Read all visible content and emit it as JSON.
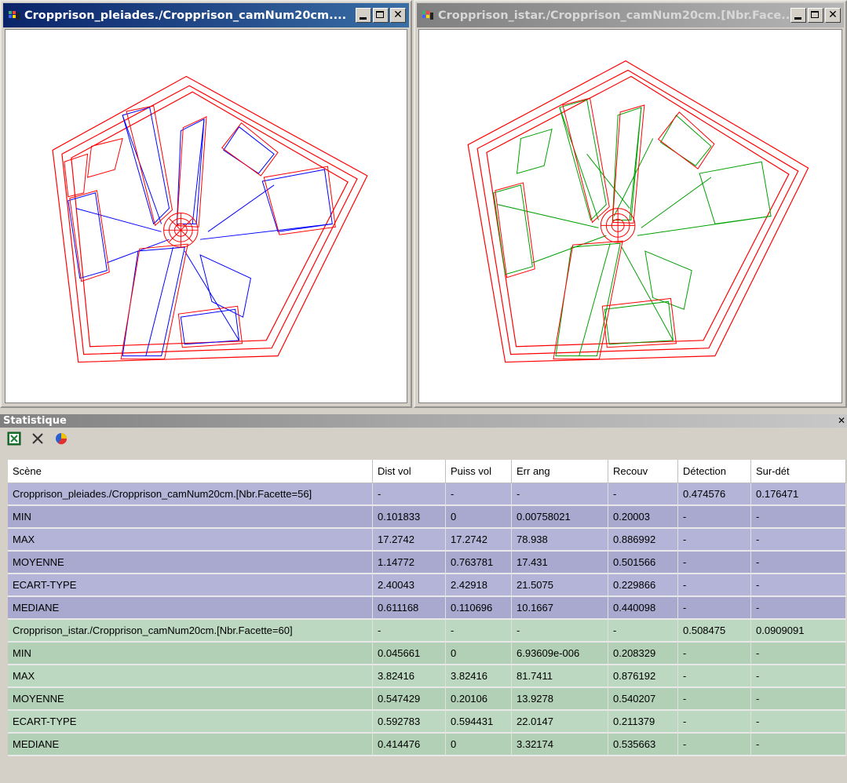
{
  "windows": {
    "left": {
      "title": "Cropprison_pleiades./Cropprison_camNum20cm...."
    },
    "right": {
      "title": "Cropprison_istar./Cropprison_camNum20cm.[Nbr.Face..."
    }
  },
  "colors": {
    "footprint": "#ff0000",
    "left_model": "#0000ff",
    "right_model": "#00a000",
    "group1_row": "#b4b4d8",
    "group2_row": "#bcd8c0"
  },
  "stats": {
    "title": "Statistique",
    "toolbar": [
      "excel-icon",
      "delete-icon",
      "chart-icon"
    ],
    "columns": [
      "Scène",
      "Dist vol",
      "Puiss vol",
      "Err ang",
      "Recouv",
      "Détection",
      "Sur-dét"
    ],
    "groups": [
      {
        "name": "Cropprison_pleiades./Cropprison_camNum20cm.[Nbr.Facette=56]",
        "header": [
          "-",
          "-",
          "-",
          "-",
          "0.474576",
          "0.176471"
        ],
        "rows": [
          [
            "MIN",
            "0.101833",
            "0",
            "0.00758021",
            "0.20003",
            "-",
            "-"
          ],
          [
            "MAX",
            "17.2742",
            "17.2742",
            "78.938",
            "0.886992",
            "-",
            "-"
          ],
          [
            "MOYENNE",
            "1.14772",
            "0.763781",
            "17.431",
            "0.501566",
            "-",
            "-"
          ],
          [
            "ECART-TYPE",
            "2.40043",
            "2.42918",
            "21.5075",
            "0.229866",
            "-",
            "-"
          ],
          [
            "MEDIANE",
            "0.611168",
            "0.110696",
            "10.1667",
            "0.440098",
            "-",
            "-"
          ]
        ]
      },
      {
        "name": "Cropprison_istar./Cropprison_camNum20cm.[Nbr.Facette=60]",
        "header": [
          "-",
          "-",
          "-",
          "-",
          "0.508475",
          "0.0909091"
        ],
        "rows": [
          [
            "MIN",
            "0.045661",
            "0",
            "6.93609e-006",
            "0.208329",
            "-",
            "-"
          ],
          [
            "MAX",
            "3.82416",
            "3.82416",
            "81.7411",
            "0.876192",
            "-",
            "-"
          ],
          [
            "MOYENNE",
            "0.547429",
            "0.20106",
            "13.9278",
            "0.540207",
            "-",
            "-"
          ],
          [
            "ECART-TYPE",
            "0.592783",
            "0.594431",
            "22.0147",
            "0.211379",
            "-",
            "-"
          ],
          [
            "MEDIANE",
            "0.414476",
            "0",
            "3.32174",
            "0.535663",
            "-",
            "-"
          ]
        ]
      }
    ]
  }
}
